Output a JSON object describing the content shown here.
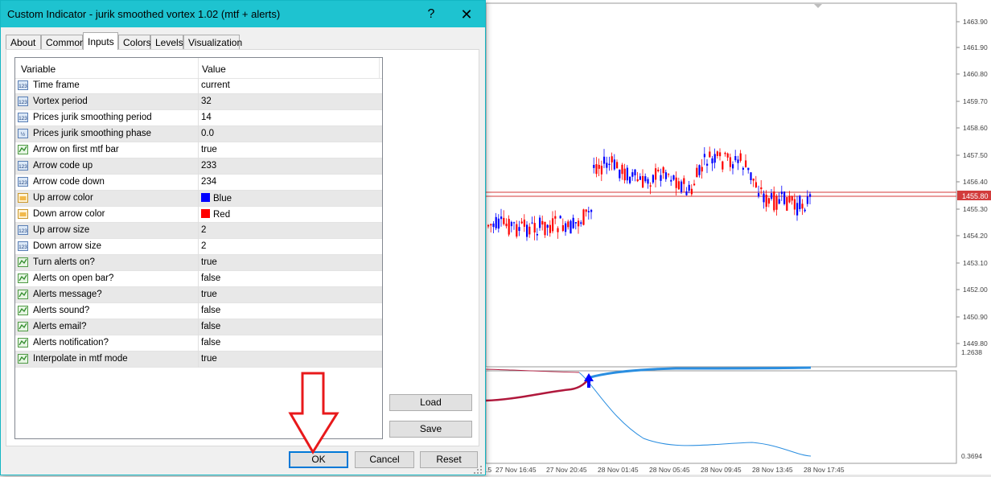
{
  "dialog": {
    "title": "Custom Indicator - jurik smoothed vortex 1.02 (mtf + alerts)",
    "help_glyph": "?",
    "close_glyph": "✕",
    "tabs": [
      {
        "label": "About",
        "active": false
      },
      {
        "label": "Common",
        "active": false
      },
      {
        "label": "Inputs",
        "active": true
      },
      {
        "label": "Colors",
        "active": false
      },
      {
        "label": "Levels",
        "active": false
      },
      {
        "label": "Visualization",
        "active": false
      }
    ],
    "grid": {
      "header_variable": "Variable",
      "header_value": "Value",
      "rows": [
        {
          "variable": "Time frame",
          "value": "current",
          "icon": "int-icon"
        },
        {
          "variable": "Vortex period",
          "value": "32",
          "icon": "int-icon"
        },
        {
          "variable": "Prices jurik smoothing period",
          "value": "14",
          "icon": "int-icon"
        },
        {
          "variable": "Prices jurik smoothing phase",
          "value": "0.0",
          "icon": "double-icon"
        },
        {
          "variable": "Arrow on first mtf bar",
          "value": "true",
          "icon": "bool-icon"
        },
        {
          "variable": "Arrow code up",
          "value": "233",
          "icon": "int-icon"
        },
        {
          "variable": "Arrow code down",
          "value": "234",
          "icon": "int-icon"
        },
        {
          "variable": "Up arrow color",
          "value": "Blue",
          "icon": "color-icon",
          "swatch": "#0000ff"
        },
        {
          "variable": "Down arrow color",
          "value": "Red",
          "icon": "color-icon",
          "swatch": "#ff0000"
        },
        {
          "variable": "Up arrow size",
          "value": "2",
          "icon": "int-icon"
        },
        {
          "variable": "Down arrow size",
          "value": "2",
          "icon": "int-icon"
        },
        {
          "variable": "Turn alerts on?",
          "value": "true",
          "icon": "bool-icon"
        },
        {
          "variable": "Alerts on open bar?",
          "value": "false",
          "icon": "bool-icon"
        },
        {
          "variable": "Alerts message?",
          "value": "true",
          "icon": "bool-icon"
        },
        {
          "variable": "Alerts sound?",
          "value": "false",
          "icon": "bool-icon"
        },
        {
          "variable": "Alerts email?",
          "value": "false",
          "icon": "bool-icon"
        },
        {
          "variable": "Alerts notification?",
          "value": "false",
          "icon": "bool-icon"
        },
        {
          "variable": "Interpolate in mtf mode",
          "value": "true",
          "icon": "bool-icon"
        }
      ]
    },
    "buttons": {
      "load": "Load",
      "save": "Save",
      "ok": "OK",
      "cancel": "Cancel",
      "reset": "Reset"
    }
  },
  "chart": {
    "price_axis": [
      "1463.90",
      "1461.90",
      "1460.80",
      "1459.70",
      "1458.60",
      "1457.50",
      "1456.40",
      "1455.30",
      "1454.20",
      "1453.10",
      "1452.00",
      "1450.90",
      "1449.80"
    ],
    "current_price": "1455.80",
    "indicator_axis": [
      "1.2638",
      "0.3694"
    ],
    "time_axis": [
      ".5",
      "27 Nov 16:45",
      "27 Nov 20:45",
      "28 Nov 01:45",
      "28 Nov 05:45",
      "28 Nov 09:45",
      "28 Nov 13:45",
      "28 Nov 17:45"
    ],
    "bull_color": "#0000ff",
    "bear_color": "#ff0000",
    "vortex_plus_color": "#2a8ee0",
    "vortex_minus_color": "#b0183c"
  },
  "annotation_arrow_color": "#e8191b"
}
